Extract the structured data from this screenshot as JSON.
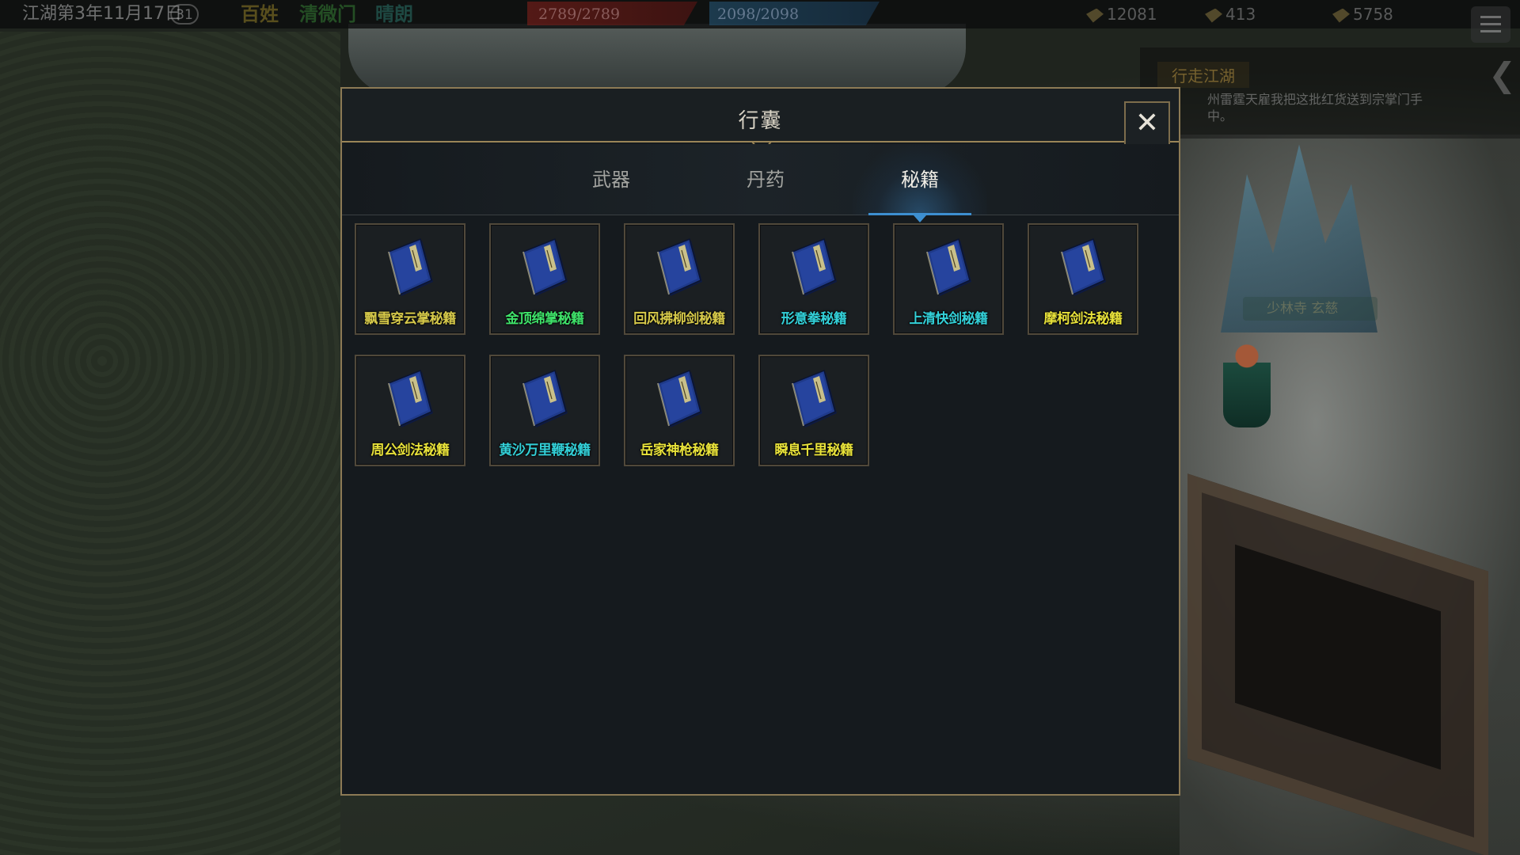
{
  "topbar": {
    "date": "江湖第3年11月17日",
    "day_count": "31",
    "stat_1": "百姓",
    "stat_2": "清微门",
    "stat_3": "晴朗",
    "hp": "2789/2789",
    "mp": "2098/2098",
    "resource_1": "12081",
    "resource_2": "413",
    "resource_3": "5758"
  },
  "quest": {
    "title": "行走江湖",
    "text": "州雷霆天雇我把这批红货送到宗掌门手中。"
  },
  "npc": {
    "name": "少林寺 玄慈"
  },
  "modal": {
    "title": "行囊",
    "close_icon": "close-icon",
    "tabs": [
      {
        "label": "武器",
        "active": false
      },
      {
        "label": "丹药",
        "active": false
      },
      {
        "label": "秘籍",
        "active": true
      }
    ],
    "items": [
      {
        "name": "飘雪穿云掌秘籍",
        "color": "#d6c94a"
      },
      {
        "name": "金顶绵掌秘籍",
        "color": "#3fe36a"
      },
      {
        "name": "回风拂柳剑秘籍",
        "color": "#d6c94a"
      },
      {
        "name": "形意拳秘籍",
        "color": "#33d0d8"
      },
      {
        "name": "上清快剑秘籍",
        "color": "#33d0d8"
      },
      {
        "name": "摩柯剑法秘籍",
        "color": "#e8e23a"
      },
      {
        "name": "周公剑法秘籍",
        "color": "#e8e23a"
      },
      {
        "name": "黄沙万里鞭秘籍",
        "color": "#33d0d8"
      },
      {
        "name": "岳家神枪秘籍",
        "color": "#e8e23a"
      },
      {
        "name": "瞬息千里秘籍",
        "color": "#e8e23a"
      }
    ]
  },
  "colors": {
    "modal_border": "#8c7a55",
    "tab_active_accent": "#3d8fd0",
    "book_cover": "#1f3a8a"
  }
}
